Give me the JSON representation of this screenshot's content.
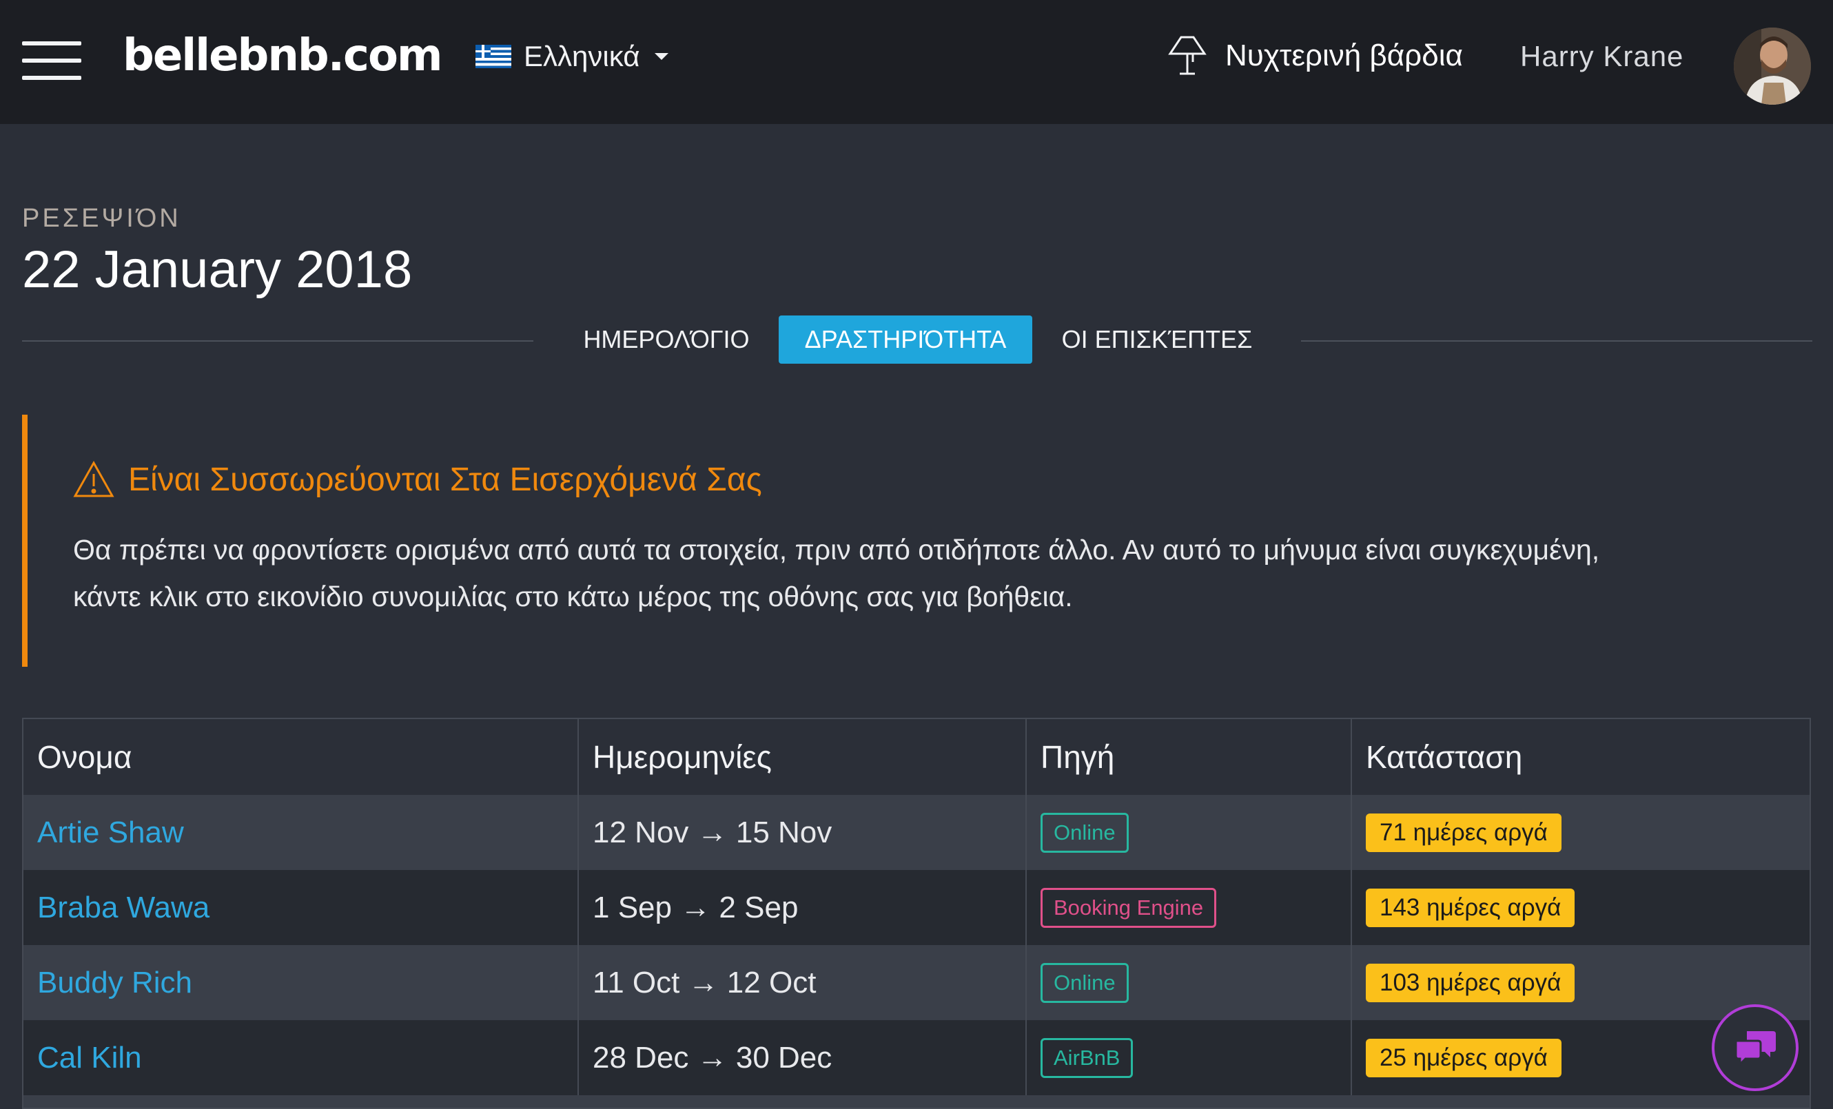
{
  "nav": {
    "logo": "bellebnb.com",
    "language": "Ελληνικά",
    "shift": "Νυχτερινή βάρδια",
    "user": "Harry Krane"
  },
  "header": {
    "section": "ΡΕΣΕΨΙΌΝ",
    "date": "22 January 2018"
  },
  "tabs": [
    {
      "label": "ΗΜΕΡΟΛΌΓΙΟ",
      "active": false
    },
    {
      "label": "ΔΡΑΣΤΗΡΙΌΤΗΤΑ",
      "active": true
    },
    {
      "label": "ΟΙ ΕΠΙΣΚΈΠΤΕΣ",
      "active": false
    }
  ],
  "alert": {
    "title": "Είναι Συσσωρεύονται Στα Εισερχόμενά Σας",
    "body_line1": "Θα πρέπει να φροντίσετε ορισμένα από αυτά τα στοιχεία, πριν από οτιδήποτε άλλο. Αν αυτό το μήνυμα είναι συγκεχυμένη,",
    "body_line2": "κάντε κλικ στο εικονίδιο συνομιλίας στο κάτω μέρος της οθόνης σας για βοήθεια."
  },
  "table": {
    "headers": [
      "Ονομα",
      "Ημερομηνίες",
      "Πηγή",
      "Κατάσταση"
    ],
    "rows": [
      {
        "name": "Artie Shaw",
        "dates": "12 Nov → 15 Nov",
        "source": "Online",
        "status": "71 ημέρες αργά"
      },
      {
        "name": "Braba Wawa",
        "dates": "1 Sep → 2 Sep",
        "source": "Booking Engine",
        "status": "143 ημέρες αργά"
      },
      {
        "name": "Buddy Rich",
        "dates": "11 Oct → 12 Oct",
        "source": "Online",
        "status": "103 ημέρες αργά"
      },
      {
        "name": "Cal Kiln",
        "dates": "28 Dec → 30 Dec",
        "source": "AirBnB",
        "status": "25 ημέρες αργά"
      }
    ]
  },
  "colors": {
    "accent": "#1fa6dc",
    "warning": "#f0890e",
    "status_badge": "#fbc01a",
    "source_online": "#27b8a0",
    "source_booking_engine": "#e0508a",
    "source_airbnb": "#27b8a0",
    "chat": "#b13dd8"
  },
  "icons": {
    "menu": "hamburger-icon",
    "language": "greek-flag-icon",
    "shift": "lamp-icon",
    "alert": "warning-triangle-icon",
    "chat": "chat-bubbles-icon"
  }
}
